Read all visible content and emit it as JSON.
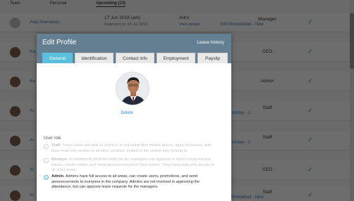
{
  "background": {
    "tabs": [
      "Team",
      "Personal",
      "Upcoming (13)"
    ],
    "rows": [
      {
        "name": "Alaji Anenasas",
        "date": "17 Jun 2018 (am)",
        "approved": "Approved on 04 Jul 2018",
        "type": "Ark's",
        "view": "View details",
        "role": "Manager",
        "office": "SIM Ahmedabad - New",
        "avatar": "grey"
      },
      {
        "name": "Ka",
        "role": "CEO",
        "office": "",
        "avatar": "photo"
      },
      {
        "name": "Ba",
        "role": "Admin",
        "office": "",
        "avatar": "photo"
      },
      {
        "name": "Ar",
        "role": "Staff",
        "office": "SIM Bombay - 1",
        "avatar": "photo"
      },
      {
        "name": "Ar",
        "role": "Staff",
        "office": "SIM Bombay - 1",
        "avatar": "photo"
      },
      {
        "name": "Ar",
        "role": "CEO",
        "office": "",
        "avatar": "photo"
      },
      {
        "name": "Al",
        "role": "Staff",
        "office": "SIM Ahmedabad - New",
        "avatar": "photo"
      }
    ]
  },
  "modal": {
    "title": "Edit Profile",
    "leave_history": "Leave history",
    "tabs": [
      "General",
      "Identification",
      "Contact info",
      "Employment",
      "Payslip"
    ],
    "active_tab": "General",
    "delete_label": "Delete",
    "user_role_label": "User role",
    "roles": [
      {
        "name": "Staff",
        "desc": "These users are able to check in or out using their mobile device, apply for leaves, and have read-only access to all other sections, limited to the outlets they belong to.",
        "selected": false
      },
      {
        "name": "Manager",
        "desc": "In addition to what the staff can do, managers can approve or reject check-ins and leaves, create rosters and send announcements to their outlets. They have read-only access to all other areas.",
        "selected": false
      },
      {
        "name": "Admin",
        "desc": "Admins have full access to all areas, can create users, promotions, and send announcements to everyone in the company. Admins are not involved in approving the attendance, but can approve leave requests for the managers.",
        "selected": true
      }
    ]
  },
  "colors": {
    "header": "#657f92",
    "accent": "#5bc0de",
    "link": "#3a8fc8"
  }
}
